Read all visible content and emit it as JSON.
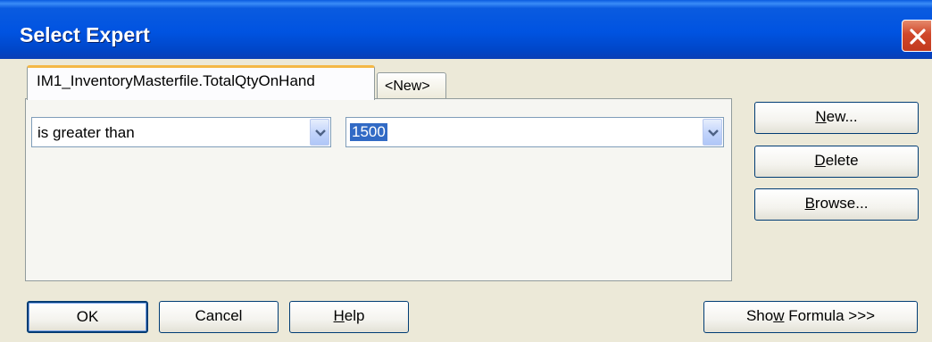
{
  "window": {
    "title": "Select Expert"
  },
  "tabs": [
    {
      "label": "IM1_InventoryMasterfile.TotalQtyOnHand"
    },
    {
      "label": "<New>"
    }
  ],
  "condition": {
    "operator": "is greater than",
    "value": "1500"
  },
  "side_buttons": {
    "new": {
      "pre": "",
      "ul": "N",
      "post": "ew..."
    },
    "delete": {
      "pre": "",
      "ul": "D",
      "post": "elete"
    },
    "browse": {
      "pre": "",
      "ul": "B",
      "post": "rowse..."
    }
  },
  "bottom_buttons": {
    "ok": "OK",
    "cancel": "Cancel",
    "help": {
      "pre": "",
      "ul": "H",
      "post": "elp"
    },
    "show_formula": {
      "pre": "Sho",
      "ul": "w",
      "post": " Formula >>>"
    }
  },
  "icons": {
    "close": "close-icon",
    "dropdown": "chevron-down-icon"
  },
  "colors": {
    "titlebar": "#0053e1",
    "close": "#d0472a",
    "selection": "#316ac5"
  }
}
